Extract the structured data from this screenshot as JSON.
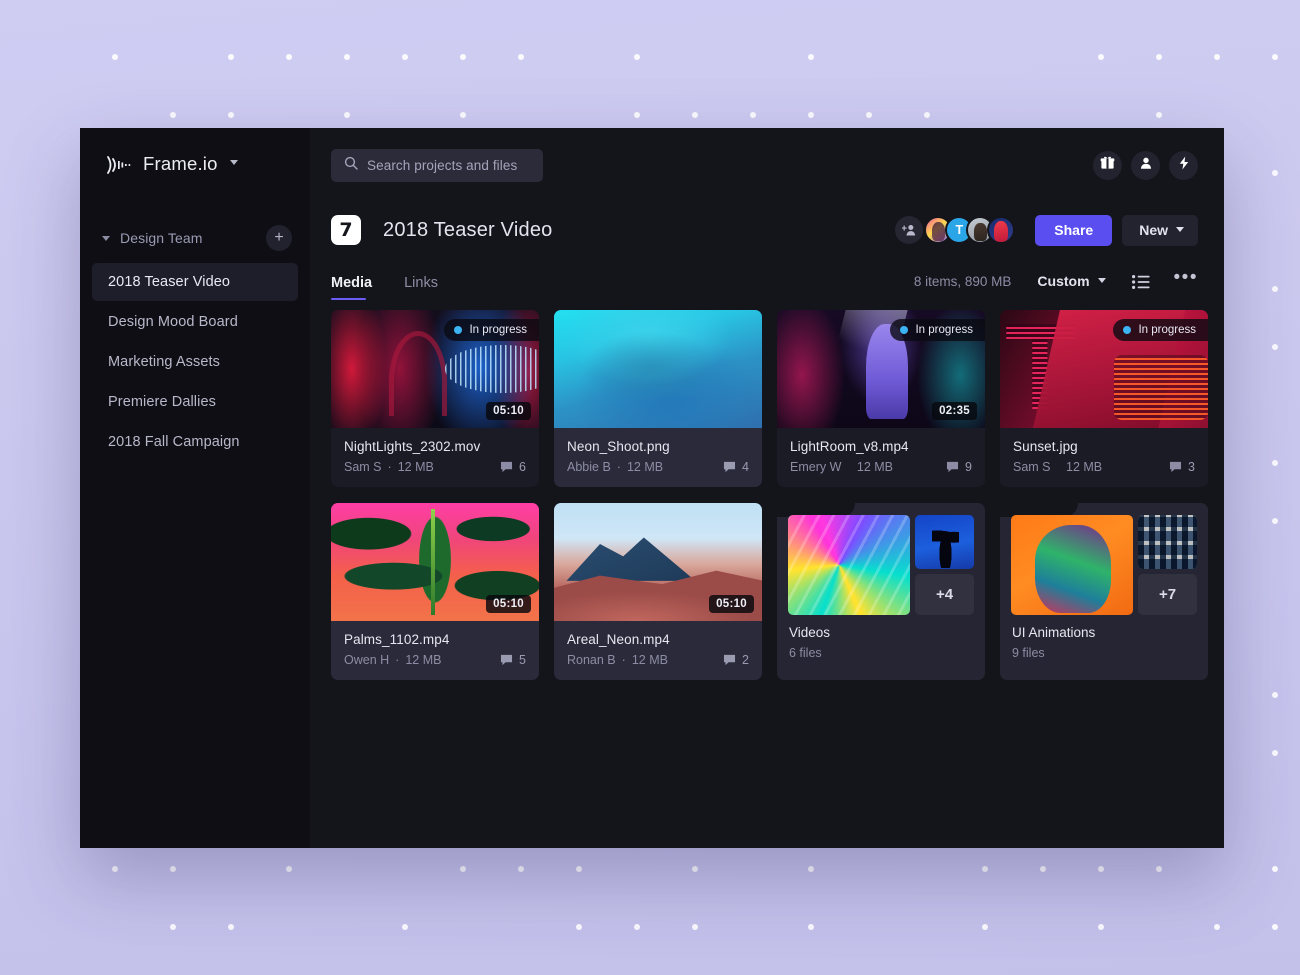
{
  "brand": {
    "name": "Frame.io",
    "logo_icon": "soundwave-logo-icon",
    "caret_icon": "chevron-down-icon"
  },
  "sidebar": {
    "team": {
      "label": "Design Team",
      "caret_icon": "chevron-down-icon",
      "add_icon": "plus-icon",
      "add_label": "+"
    },
    "projects": [
      {
        "label": "2018 Teaser Video",
        "active": true
      },
      {
        "label": "Design Mood Board",
        "active": false
      },
      {
        "label": "Marketing Assets",
        "active": false
      },
      {
        "label": "Premiere Dallies",
        "active": false
      },
      {
        "label": "2018 Fall Campaign",
        "active": false
      }
    ]
  },
  "topbar": {
    "search": {
      "placeholder": "Search projects and files",
      "value": "",
      "icon": "search-icon"
    },
    "actions": [
      {
        "icon": "gift-icon",
        "name": "gift-button"
      },
      {
        "icon": "person-icon",
        "name": "account-button"
      },
      {
        "icon": "lightning-bolt-icon",
        "name": "upgrade-button"
      }
    ]
  },
  "project": {
    "icon_glyph": "7",
    "title": "2018 Teaser Video",
    "add_people_icon": "add-person-icon",
    "collaborators": [
      {
        "initial": "",
        "name": "collaborator-avatar-1"
      },
      {
        "initial": "T",
        "name": "collaborator-avatar-2"
      },
      {
        "initial": "",
        "name": "collaborator-avatar-3"
      },
      {
        "initial": "",
        "name": "collaborator-avatar-4"
      }
    ],
    "share_label": "Share",
    "new_label": "New",
    "new_caret_icon": "chevron-down-icon",
    "accent_color": "#5b4ef0"
  },
  "tabs": [
    {
      "label": "Media",
      "active": true
    },
    {
      "label": "Links",
      "active": false
    }
  ],
  "toolbar": {
    "count_text": "8 items, 890 MB",
    "sort_label": "Custom",
    "sort_caret_icon": "chevron-down-icon",
    "view_icon": "list-view-icon",
    "more_icon": "ellipsis-icon",
    "more_label": "•••"
  },
  "assets": [
    {
      "type": "file",
      "name": "NightLights_2302.mov",
      "owner": "Sam S",
      "size": "12 MB",
      "comments": "6",
      "duration": "05:10",
      "status": "In progress",
      "status_color": "#3cb3f2",
      "art": "art-night",
      "highlight": false
    },
    {
      "type": "file",
      "name": "Neon_Shoot.png",
      "owner": "Abbie B",
      "size": "12 MB",
      "comments": "4",
      "duration": "",
      "status": "",
      "status_color": "",
      "art": "art-neon",
      "highlight": true
    },
    {
      "type": "file",
      "name": "LightRoom_v8.mp4",
      "owner": "Emery W",
      "size": "12 MB",
      "comments": "9",
      "duration": "02:35",
      "status": "In progress",
      "status_color": "#3cb3f2",
      "art": "art-light",
      "highlight": false
    },
    {
      "type": "file",
      "name": "Sunset.jpg",
      "owner": "Sam S",
      "size": "12 MB",
      "comments": "3",
      "duration": "",
      "status": "In progress",
      "status_color": "#3cb3f2",
      "art": "art-sunset",
      "highlight": false
    },
    {
      "type": "file",
      "name": "Palms_1102.mp4",
      "owner": "Owen H",
      "size": "12 MB",
      "comments": "5",
      "duration": "05:10",
      "status": "",
      "status_color": "",
      "art": "art-palms",
      "highlight": true
    },
    {
      "type": "file",
      "name": "Areal_Neon.mp4",
      "owner": "Ronan B",
      "size": "12 MB",
      "comments": "2",
      "duration": "05:10",
      "status": "",
      "status_color": "",
      "art": "art-areal",
      "highlight": true
    }
  ],
  "folders": [
    {
      "name": "Videos",
      "count_text": "6 files",
      "more_label": "+4",
      "art_main": "art-swirl",
      "art_small": "art-palm2"
    },
    {
      "name": "UI Animations",
      "count_text": "9 files",
      "more_label": "+7",
      "art_main": "art-face",
      "art_small": "art-build"
    }
  ],
  "background": {
    "page_color": "#cbc9ef",
    "dot_color": "#ffffff"
  }
}
